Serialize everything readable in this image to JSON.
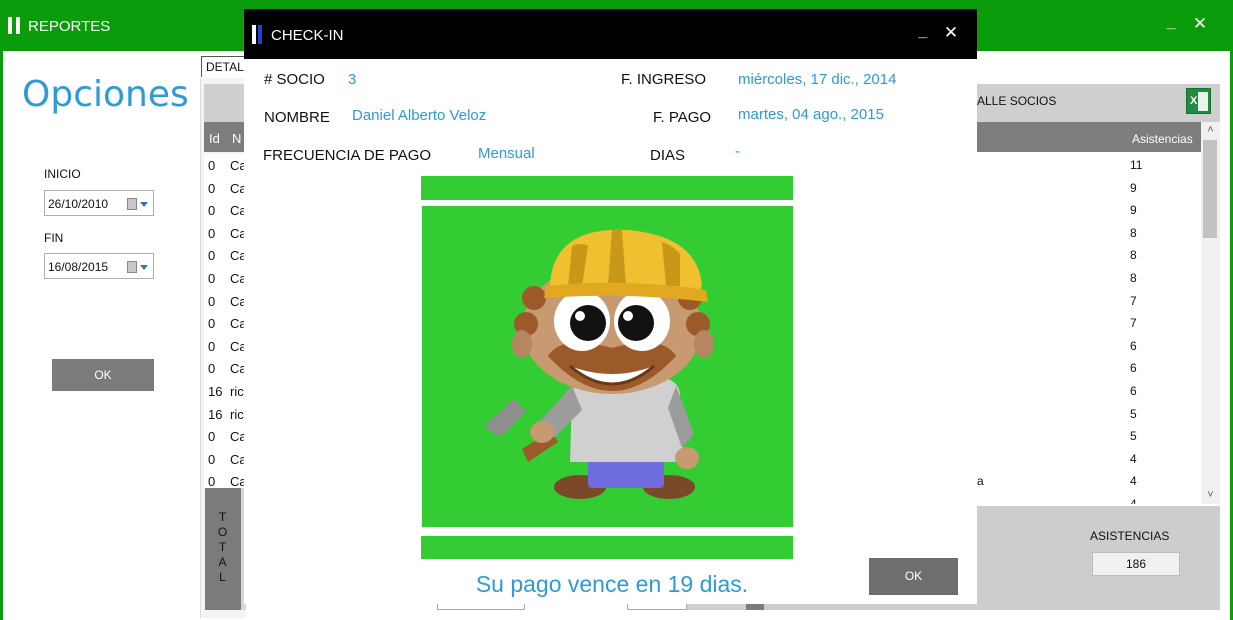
{
  "window": {
    "title": "REPORTES",
    "minimize": "_",
    "close": "✕"
  },
  "options": {
    "heading": "Opciones",
    "inicio_label": "INICIO",
    "inicio_value": "26/10/2010",
    "fin_label": "FIN",
    "fin_value": "16/08/2015",
    "ok_label": "OK"
  },
  "left_grid": {
    "tab_label": "DETAL",
    "col_id": "Id",
    "col_n": "N",
    "rows": [
      {
        "id": "0",
        "n": "Ca"
      },
      {
        "id": "0",
        "n": "Ca"
      },
      {
        "id": "0",
        "n": "Ca"
      },
      {
        "id": "0",
        "n": "Ca"
      },
      {
        "id": "0",
        "n": "Ca"
      },
      {
        "id": "0",
        "n": "Ca"
      },
      {
        "id": "0",
        "n": "Ca"
      },
      {
        "id": "0",
        "n": "Ca"
      },
      {
        "id": "0",
        "n": "Ca"
      },
      {
        "id": "0",
        "n": "Ca"
      },
      {
        "id": "16",
        "n": "ric"
      },
      {
        "id": "16",
        "n": "ric"
      },
      {
        "id": "0",
        "n": "Ca"
      },
      {
        "id": "0",
        "n": "Ca"
      },
      {
        "id": "0",
        "n": "Ca"
      }
    ],
    "total_label": "TOTAL"
  },
  "right_grid": {
    "header_label": "ALLE SOCIOS",
    "export_icon": "excel-icon",
    "col_asistencias": "Asistencias",
    "rows": [
      {
        "text": "",
        "value": "11"
      },
      {
        "text": "",
        "value": "9"
      },
      {
        "text": "",
        "value": "9"
      },
      {
        "text": "",
        "value": "8"
      },
      {
        "text": "",
        "value": "8"
      },
      {
        "text": "",
        "value": "8"
      },
      {
        "text": "",
        "value": "7"
      },
      {
        "text": "",
        "value": "7"
      },
      {
        "text": "",
        "value": "6"
      },
      {
        "text": "",
        "value": "6"
      },
      {
        "text": "",
        "value": "6"
      },
      {
        "text": "",
        "value": "5"
      },
      {
        "text": "",
        "value": "5"
      },
      {
        "text": "",
        "value": "4"
      },
      {
        "text": "a",
        "value": "4"
      },
      {
        "text": "",
        "value": "4"
      }
    ],
    "asistencias_label": "ASISTENCIAS",
    "asistencias_total": "186"
  },
  "checkin": {
    "title": "CHECK-IN",
    "minimize": "_",
    "close": "✕",
    "socio_label": "# SOCIO",
    "socio_value": "3",
    "nombre_label": "NOMBRE",
    "nombre_value": "Daniel Alberto Veloz",
    "frecuencia_label": "FRECUENCIA DE PAGO",
    "frecuencia_value": "Mensual",
    "ingreso_label": "F. INGRESO",
    "ingreso_value": "miércoles, 17 dic., 2014",
    "pago_label": "F. PAGO",
    "pago_value": "martes, 04 ago., 2015",
    "dias_label": "DIAS",
    "dias_value": "-",
    "due_message": "Su pago vence en 19 dias.",
    "ok_label": "OK",
    "status_color": "#33cc33",
    "photo_icon": "worker-avatar-icon"
  },
  "colors": {
    "window_green": "#0a9c0a",
    "accent_blue": "#2e9ad6",
    "status_green": "#33cc33",
    "dialog_titlebar": "#000000"
  }
}
